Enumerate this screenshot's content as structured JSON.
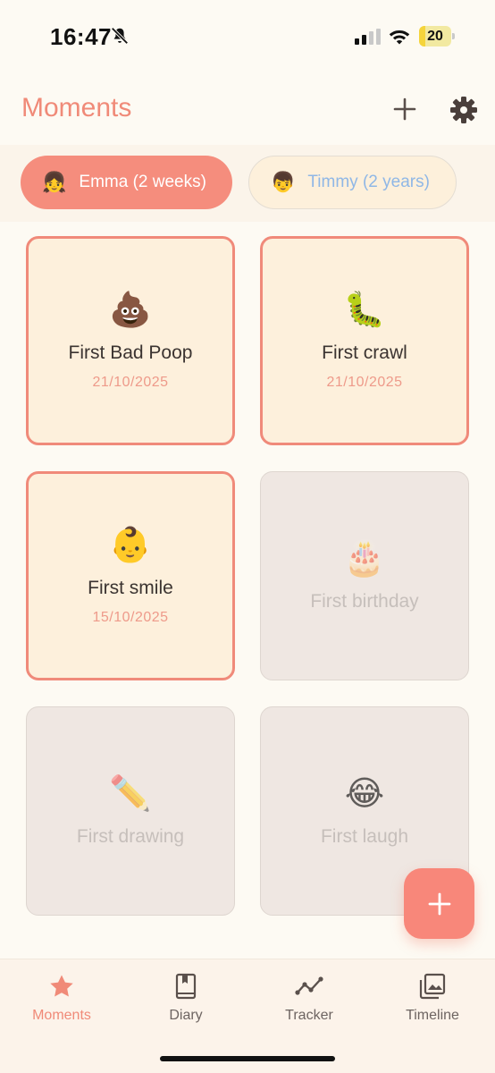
{
  "status": {
    "time": "16:47",
    "battery": "20",
    "battery_level": 0.2
  },
  "header": {
    "title": "Moments"
  },
  "children": [
    {
      "emoji": "👧",
      "label": "Emma (2 weeks)"
    },
    {
      "emoji": "👦",
      "label": "Timmy (2 years)"
    }
  ],
  "moments": [
    {
      "emoji": "💩",
      "title": "First Bad Poop",
      "date": "21/10/2025"
    },
    {
      "emoji": "🐛",
      "title": "First crawl",
      "date": "21/10/2025"
    },
    {
      "emoji": "👶",
      "title": "First smile",
      "date": "15/10/2025"
    },
    {
      "emoji": "🎂",
      "title": "First birthday"
    },
    {
      "emoji": "✏️",
      "title": "First drawing"
    },
    {
      "emoji": "😂",
      "title": "First laugh"
    }
  ],
  "nav": [
    {
      "label": "Moments",
      "icon": "star-icon"
    },
    {
      "label": "Diary",
      "icon": "book-icon"
    },
    {
      "label": "Tracker",
      "icon": "trend-line-icon"
    },
    {
      "label": "Timeline",
      "icon": "photo-stack-icon"
    }
  ],
  "colors": {
    "accent": "#f58d7d",
    "background": "#fdfaf3",
    "card_done": "#fdf0dc",
    "card_todo": "#efe7e2"
  }
}
